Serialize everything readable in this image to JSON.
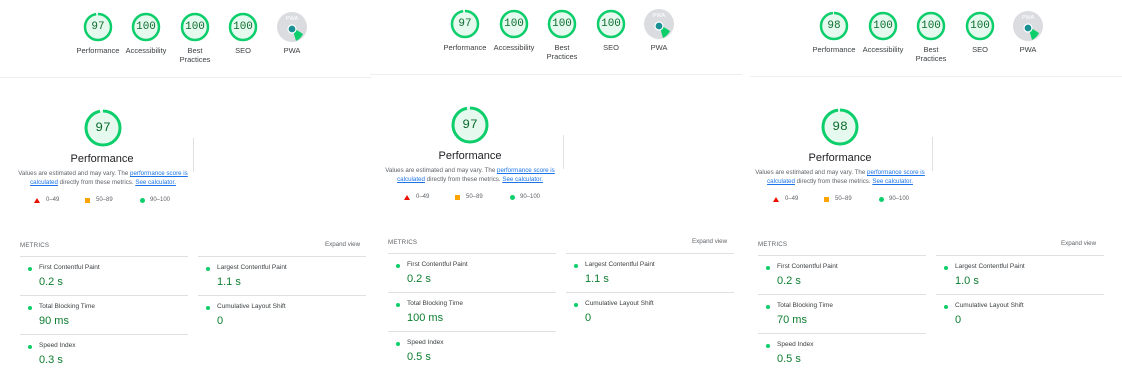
{
  "colors": {
    "pass": "#0cce6b",
    "pass_text": "#0c6d2f",
    "average": "#ffa400",
    "fail": "#eb0f00",
    "link": "#1a73e8",
    "pwa_gray": "#dadce0"
  },
  "reports": [
    {
      "categories": [
        {
          "score": "97",
          "label": "Performance",
          "value": 0.97
        },
        {
          "score": "100",
          "label": "Accessibility",
          "value": 1
        },
        {
          "score": "100",
          "label": "Best Practices",
          "value": 1
        },
        {
          "score": "100",
          "label": "SEO",
          "value": 1
        },
        {
          "label": "PWA",
          "badge_text": "PWA",
          "icon": "pwa-badge-icon"
        }
      ],
      "gauge": {
        "score": "97",
        "value": 0.97,
        "title": "Performance"
      },
      "desc": {
        "pre": "Values are estimated and may vary. The ",
        "link1": "performance score is calculated",
        "mid": " directly from these metrics. ",
        "link2": "See calculator."
      },
      "legend": {
        "fail": "0–49",
        "average": "50–89",
        "pass": "90–100"
      },
      "metrics_label": "METRICS",
      "expand": "Expand view",
      "metrics": [
        {
          "name": "First Contentful Paint",
          "value": "0.2 s"
        },
        {
          "name": "Largest Contentful Paint",
          "value": "1.1 s"
        },
        {
          "name": "Total Blocking Time",
          "value": "90 ms"
        },
        {
          "name": "Cumulative Layout Shift",
          "value": "0"
        },
        {
          "name": "Speed Index",
          "value": "0.3 s"
        }
      ]
    },
    {
      "categories": [
        {
          "score": "97",
          "label": "Performance",
          "value": 0.97
        },
        {
          "score": "100",
          "label": "Accessibility",
          "value": 1
        },
        {
          "score": "100",
          "label": "Best Practices",
          "value": 1
        },
        {
          "score": "100",
          "label": "SEO",
          "value": 1
        },
        {
          "label": "PWA",
          "badge_text": "PWA",
          "icon": "pwa-badge-icon"
        }
      ],
      "gauge": {
        "score": "97",
        "value": 0.97,
        "title": "Performance"
      },
      "desc": {
        "pre": "Values are estimated and may vary. The ",
        "link1": "performance score is calculated",
        "mid": " directly from these metrics. ",
        "link2": "See calculator."
      },
      "legend": {
        "fail": "0–49",
        "average": "50–89",
        "pass": "90–100"
      },
      "metrics_label": "METRICS",
      "expand": "Expand view",
      "metrics": [
        {
          "name": "First Contentful Paint",
          "value": "0.2 s"
        },
        {
          "name": "Largest Contentful Paint",
          "value": "1.1 s"
        },
        {
          "name": "Total Blocking Time",
          "value": "100 ms"
        },
        {
          "name": "Cumulative Layout Shift",
          "value": "0"
        },
        {
          "name": "Speed Index",
          "value": "0.5 s"
        }
      ]
    },
    {
      "categories": [
        {
          "score": "98",
          "label": "Performance",
          "value": 0.98
        },
        {
          "score": "100",
          "label": "Accessibility",
          "value": 1
        },
        {
          "score": "100",
          "label": "Best Practices",
          "value": 1
        },
        {
          "score": "100",
          "label": "SEO",
          "value": 1
        },
        {
          "label": "PWA",
          "badge_text": "PWA",
          "icon": "pwa-badge-icon"
        }
      ],
      "gauge": {
        "score": "98",
        "value": 0.98,
        "title": "Performance"
      },
      "desc": {
        "pre": "Values are estimated and may vary. The ",
        "link1": "performance score is calculated",
        "mid": " directly from these metrics. ",
        "link2": "See calculator."
      },
      "legend": {
        "fail": "0–49",
        "average": "50–89",
        "pass": "90–100"
      },
      "metrics_label": "METRICS",
      "expand": "Expand view",
      "metrics": [
        {
          "name": "First Contentful Paint",
          "value": "0.2 s"
        },
        {
          "name": "Largest Contentful Paint",
          "value": "1.0 s"
        },
        {
          "name": "Total Blocking Time",
          "value": "70 ms"
        },
        {
          "name": "Cumulative Layout Shift",
          "value": "0"
        },
        {
          "name": "Speed Index",
          "value": "0.5 s"
        }
      ]
    }
  ]
}
